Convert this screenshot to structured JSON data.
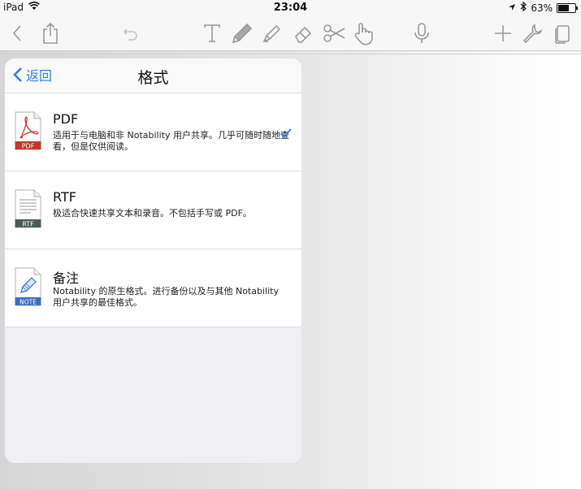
{
  "status_bar": {
    "device": "iPad",
    "time": "23:04",
    "battery": "63%",
    "battery_level": 0.63
  },
  "toolbar": {
    "icons": [
      "chevron-left-icon",
      "share-icon",
      "undo-icon",
      "text-icon",
      "pencil-icon",
      "highlighter-icon",
      "eraser-icon",
      "scissors-icon",
      "hand-icon",
      "microphone-icon",
      "plus-icon",
      "wrench-icon",
      "pages-icon"
    ]
  },
  "popover": {
    "back_label": "返回",
    "title": "格式",
    "options": [
      {
        "title": "PDF",
        "badge": "PDF",
        "badge_color": "#c0392b",
        "description": "适用于与电脑和非 Notability 用户共享。几乎可随时随地查看，但是仅供阅读。",
        "selected": true
      },
      {
        "title": "RTF",
        "badge": "RTF",
        "badge_color": "#4d5a5a",
        "description": "极适合快速共享文本和录音。不包括手写或 PDF。",
        "selected": false
      },
      {
        "title": "备注",
        "badge": "NOTE",
        "badge_color": "#3a6fc4",
        "description": "Notability 的原生格式。进行备份以及与其他 Notability 用户共享的最佳格式。",
        "selected": false
      }
    ]
  },
  "colors": {
    "accent": "#2f80ed",
    "icon_gray": "#9a9a9a"
  }
}
